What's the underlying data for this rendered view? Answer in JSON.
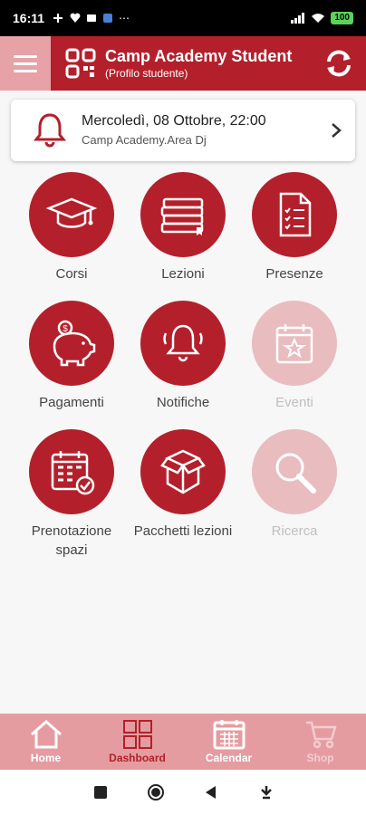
{
  "status": {
    "time": "16:11",
    "more": "⋯",
    "battery": "100"
  },
  "header": {
    "title": "Camp Academy Student",
    "subtitle": "(Profilo studente)"
  },
  "notification": {
    "date": "Mercoledì, 08 Ottobre, 22:00",
    "place": "Camp Academy.Area Dj"
  },
  "tiles": [
    {
      "label": "Corsi",
      "icon": "graduation-cap-icon",
      "enabled": true
    },
    {
      "label": "Lezioni",
      "icon": "books-icon",
      "enabled": true
    },
    {
      "label": "Presenze",
      "icon": "checklist-document-icon",
      "enabled": true
    },
    {
      "label": "Pagamenti",
      "icon": "piggy-bank-icon",
      "enabled": true
    },
    {
      "label": "Notifiche",
      "icon": "bell-icon",
      "enabled": true
    },
    {
      "label": "Eventi",
      "icon": "calendar-star-icon",
      "enabled": false
    },
    {
      "label": "Prenotazione spazi",
      "icon": "calendar-check-icon",
      "enabled": true
    },
    {
      "label": "Pacchetti lezioni",
      "icon": "open-box-icon",
      "enabled": true
    },
    {
      "label": "Ricerca",
      "icon": "magnifier-icon",
      "enabled": false
    }
  ],
  "nav": [
    {
      "label": "Home",
      "icon": "home-icon",
      "state": "normal"
    },
    {
      "label": "Dashboard",
      "icon": "grid-icon",
      "state": "active"
    },
    {
      "label": "Calendar",
      "icon": "calendar-icon",
      "state": "normal"
    },
    {
      "label": "Shop",
      "icon": "cart-icon",
      "state": "disabled"
    }
  ],
  "colors": {
    "primary": "#b3202b",
    "primary_light": "#e9bcc0",
    "nav_bg": "#e59ca1"
  }
}
